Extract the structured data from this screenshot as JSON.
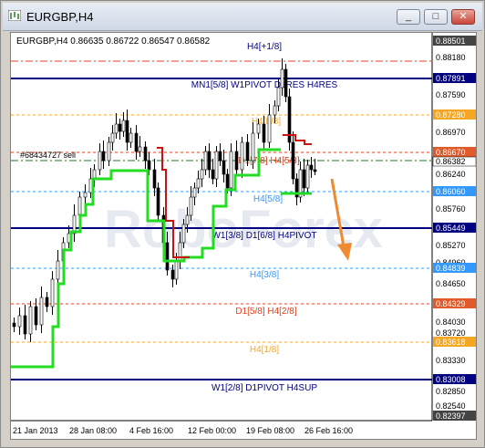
{
  "window": {
    "title": "EURGBP,H4",
    "minimize_label": "_",
    "maximize_label": "□",
    "close_label": "✕"
  },
  "colors": {
    "navy": "#000080",
    "red": "#e04020",
    "orange": "#f5a623",
    "blue": "#3399ff",
    "green": "#22dd22",
    "price_red": "#e05a2a"
  },
  "chart": {
    "header": "EURGBP,H4  0.86635 0.86722 0.86547 0.86582",
    "watermark": "RoboForex",
    "trade_label": "#68434727 sell",
    "price_axis": [
      "0.88501",
      "0.88180",
      "0.87891",
      "0.87590",
      "0.87280",
      "0.86970",
      "0.86670",
      "0.86382",
      "0.86240",
      "0.86060",
      "0.85760",
      "0.85449",
      "0.85270",
      "0.84960",
      "0.84839",
      "0.84650",
      "0.84329",
      "0.84030",
      "0.83720",
      "0.83618",
      "0.83330",
      "0.83008",
      "0.82850",
      "0.82540",
      "0.82397"
    ],
    "time_axis": [
      "21 Jan 2013",
      "28 Jan 08:00",
      "4 Feb 16:00",
      "12 Feb 00:00",
      "19 Feb 08:00",
      "26 Feb 16:00"
    ],
    "level_labels": {
      "h4_p18": "H4[+1/8]",
      "mn1_58": "MN1[5/8] W1PIVOT D1RES H4RES",
      "h4_88": "H4[8/8]",
      "d1_78": "D1[7/8] H4[5/8]",
      "h4_58": "H4[5/8]",
      "w1_38": "W1[3/8] D1[6/8] H4PIVOT",
      "h4_38": "H4[3/8]",
      "d1_58": "D1[5/8] H4[2/8]",
      "h4_18": "H4[1/8]",
      "w1_28": "W1[2/8] D1PIVOT H4SUP"
    }
  }
}
